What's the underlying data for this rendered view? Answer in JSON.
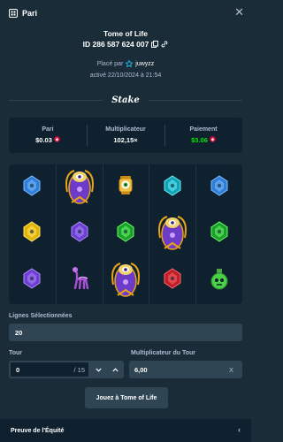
{
  "header": {
    "title": "Pari"
  },
  "bet": {
    "game_title": "Tome of Life",
    "id_label": "ID 286 587 624 007",
    "placed_by_label": "Placé par",
    "username": "juwyzz",
    "activated": "activé 22/10/2024 à 21:54",
    "brand": "Stake"
  },
  "stats": {
    "bet_label": "Pari",
    "bet_value": "$0.03",
    "multiplier_label": "Multiplicateur",
    "multiplier_value": "102,15×",
    "payout_label": "Paiement",
    "payout_value": "$3.06"
  },
  "reels": [
    [
      "gem-blue",
      "eye-totem",
      "eye-lantern",
      "gem-teal",
      "gem-blue"
    ],
    [
      "gem-yellow",
      "gem-purple",
      "gem-green",
      "eye-totem",
      "gem-green"
    ],
    [
      "gem-purple",
      "llama",
      "eye-totem",
      "gem-red",
      "skull-potion"
    ]
  ],
  "lines": {
    "label": "Lignes Sélectionnées",
    "value": "20"
  },
  "round": {
    "label": "Tour",
    "value": "0",
    "total": "/ 15"
  },
  "round_multiplier": {
    "label": "Multiplicateur du Tour",
    "value": "6,00",
    "suffix": "X"
  },
  "play_label": "Jouez à Tome of Life",
  "footer": {
    "label": "Preuve de l'Équité"
  },
  "colors": {
    "bg": "#1a2c38",
    "panel": "#0f212e",
    "input": "#2f4553",
    "accent_green": "#00e701",
    "muted": "#b1bad3"
  }
}
